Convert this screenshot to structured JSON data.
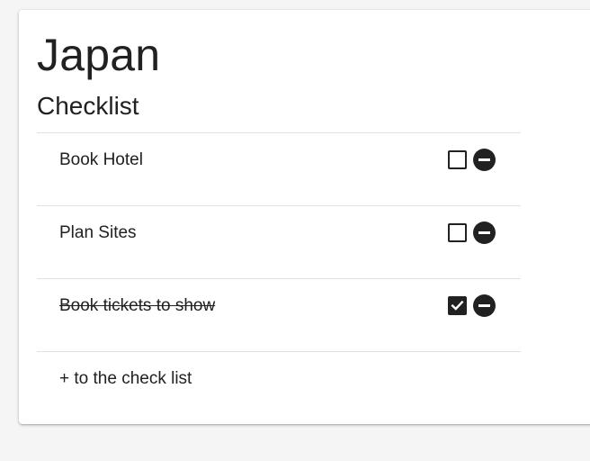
{
  "trip": {
    "title": "Japan",
    "checklist_heading": "Checklist"
  },
  "checklist": {
    "items": [
      {
        "label": "Book Hotel",
        "checked": false
      },
      {
        "label": "Plan Sites",
        "checked": false
      },
      {
        "label": "Book tickets to show",
        "checked": true
      }
    ],
    "add_label": "+ to the check list"
  },
  "icons": {
    "checkbox": "checkbox-icon",
    "checked": "check-icon",
    "remove": "remove-circle-icon"
  },
  "colors": {
    "text": "#212121",
    "divider": "#e0e0e0",
    "card": "#ffffff",
    "background": "#f5f5f5"
  }
}
